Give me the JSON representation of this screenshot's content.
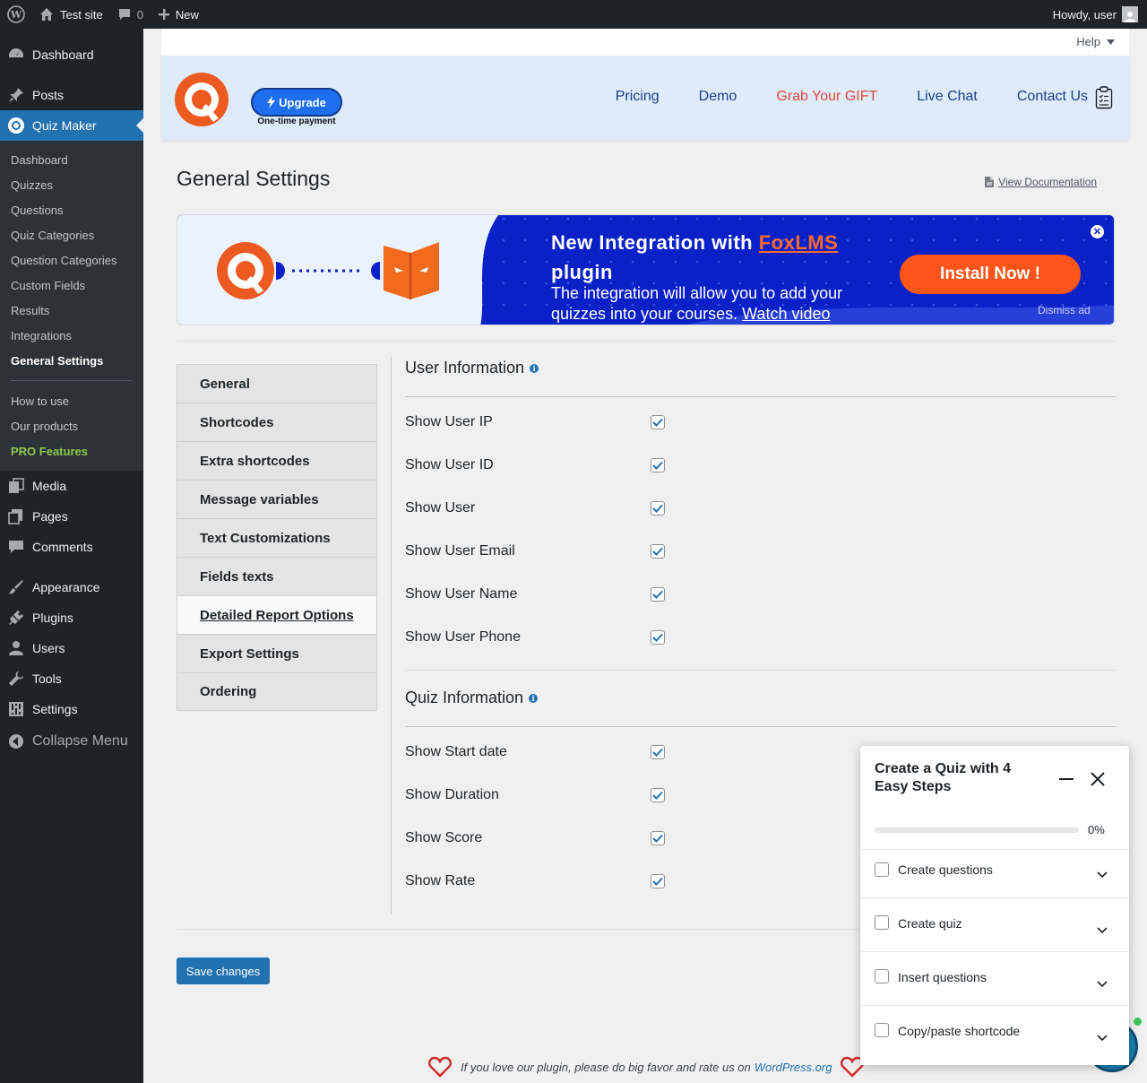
{
  "adminbar": {
    "site_name": "Test site",
    "comments_count": "0",
    "new_label": "New",
    "howdy": "Howdy, user"
  },
  "sidebar": {
    "dashboard": "Dashboard",
    "posts": "Posts",
    "quiz_maker": "Quiz Maker",
    "submenu": [
      "Dashboard",
      "Quizzes",
      "Questions",
      "Quiz Categories",
      "Question Categories",
      "Custom Fields",
      "Results",
      "Integrations",
      "General Settings"
    ],
    "submenu_extra": [
      "How to use",
      "Our products",
      "PRO Features"
    ],
    "media": "Media",
    "pages": "Pages",
    "comments": "Comments",
    "appearance": "Appearance",
    "plugins": "Plugins",
    "users": "Users",
    "tools": "Tools",
    "settings": "Settings",
    "collapse": "Collapse Menu"
  },
  "header": {
    "help": "Help",
    "upgrade": "Upgrade",
    "one_time": "One-time payment",
    "nav": [
      "Pricing",
      "Demo",
      "Grab Your GIFT",
      "Live Chat",
      "Contact Us"
    ]
  },
  "page": {
    "title": "General Settings",
    "view_doc": "View Documentation"
  },
  "promo": {
    "headline_prefix": "New Integration with ",
    "headline_brand": "FoxLMS",
    "headline_suffix": "plugin",
    "desc": "The integration will allow you to add your quizzes into your courses. ",
    "watch": "Watch video",
    "install": "Install Now !",
    "dismiss": "Dismiss ad"
  },
  "tabs": [
    "General",
    "Shortcodes",
    "Extra shortcodes",
    "Message variables",
    "Text Customizations",
    "Fields texts",
    "Detailed Report Options",
    "Export Settings",
    "Ordering"
  ],
  "active_tab": "Detailed Report Options",
  "user_info": {
    "title": "User Information",
    "options": [
      {
        "label": "Show User IP",
        "checked": true
      },
      {
        "label": "Show User ID",
        "checked": true
      },
      {
        "label": "Show User",
        "checked": true
      },
      {
        "label": "Show User Email",
        "checked": true
      },
      {
        "label": "Show User Name",
        "checked": true
      },
      {
        "label": "Show User Phone",
        "checked": true
      }
    ]
  },
  "quiz_info": {
    "title": "Quiz Information",
    "options": [
      {
        "label": "Show Start date",
        "checked": true
      },
      {
        "label": "Show Duration",
        "checked": true
      },
      {
        "label": "Show Score",
        "checked": true
      },
      {
        "label": "Show Rate",
        "checked": true
      }
    ]
  },
  "save": "Save changes",
  "footer": {
    "text": "If you love our plugin, please do big favor and rate us on",
    "link": "WordPress.org"
  },
  "steps_widget": {
    "title": "Create a Quiz with 4 Easy Steps",
    "progress": 0,
    "progress_label": "0%",
    "steps": [
      "Create questions",
      "Create quiz",
      "Insert questions",
      "Copy/paste shortcode"
    ]
  },
  "colors": {
    "wp_blue": "#2271b1",
    "admin_dark": "#1d2327",
    "promo_blue": "#0a21c8",
    "accent_orange": "#ff5518",
    "gift_red": "#e2493a"
  }
}
